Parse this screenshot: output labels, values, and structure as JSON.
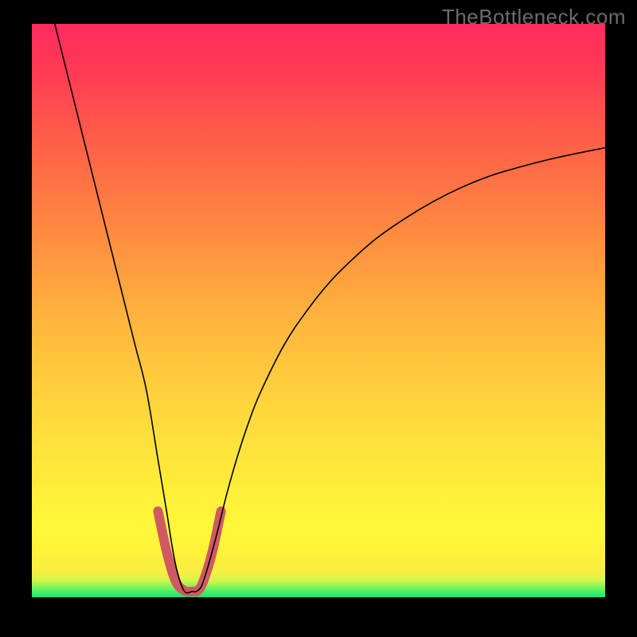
{
  "watermark": "TheBottleneck.com",
  "chart_data": {
    "type": "line",
    "title": "",
    "xlabel": "",
    "ylabel": "",
    "xlim": [
      0,
      100
    ],
    "ylim": [
      0,
      100
    ],
    "grid": false,
    "legend": false,
    "annotations": [],
    "background": {
      "gradient": [
        "#17e86f",
        "#fff83a",
        "#ff8a41",
        "#ff2c5f"
      ],
      "direction": "bottom-to-top"
    },
    "series": [
      {
        "name": "bottleneck-curve",
        "color": "#000000",
        "stroke_width": 1.6,
        "x": [
          4,
          6,
          8,
          10,
          12,
          14,
          16,
          18,
          20,
          22,
          23.5,
          25,
          26.5,
          28,
          29,
          30,
          32,
          34,
          36,
          38,
          40,
          44,
          48,
          52,
          56,
          60,
          65,
          70,
          75,
          80,
          85,
          90,
          95,
          100
        ],
        "values": [
          100,
          92,
          84,
          76,
          68,
          60,
          52,
          44,
          36,
          24,
          15,
          6,
          1.2,
          1.0,
          1.2,
          3,
          10,
          18,
          25,
          31,
          36,
          44,
          50,
          55,
          59,
          62.5,
          66,
          69,
          71.5,
          73.5,
          75,
          76.3,
          77.4,
          78.4
        ]
      },
      {
        "name": "highlight-segment",
        "color": "#cf5a63",
        "stroke_width": 12,
        "x": [
          22,
          23.5,
          25,
          26.5,
          28,
          29,
          30,
          31.5,
          33
        ],
        "values": [
          15,
          8,
          3,
          1.2,
          1.0,
          1.2,
          3,
          8,
          15
        ]
      }
    ],
    "min_point": {
      "x": 28,
      "value": 1.0
    }
  }
}
